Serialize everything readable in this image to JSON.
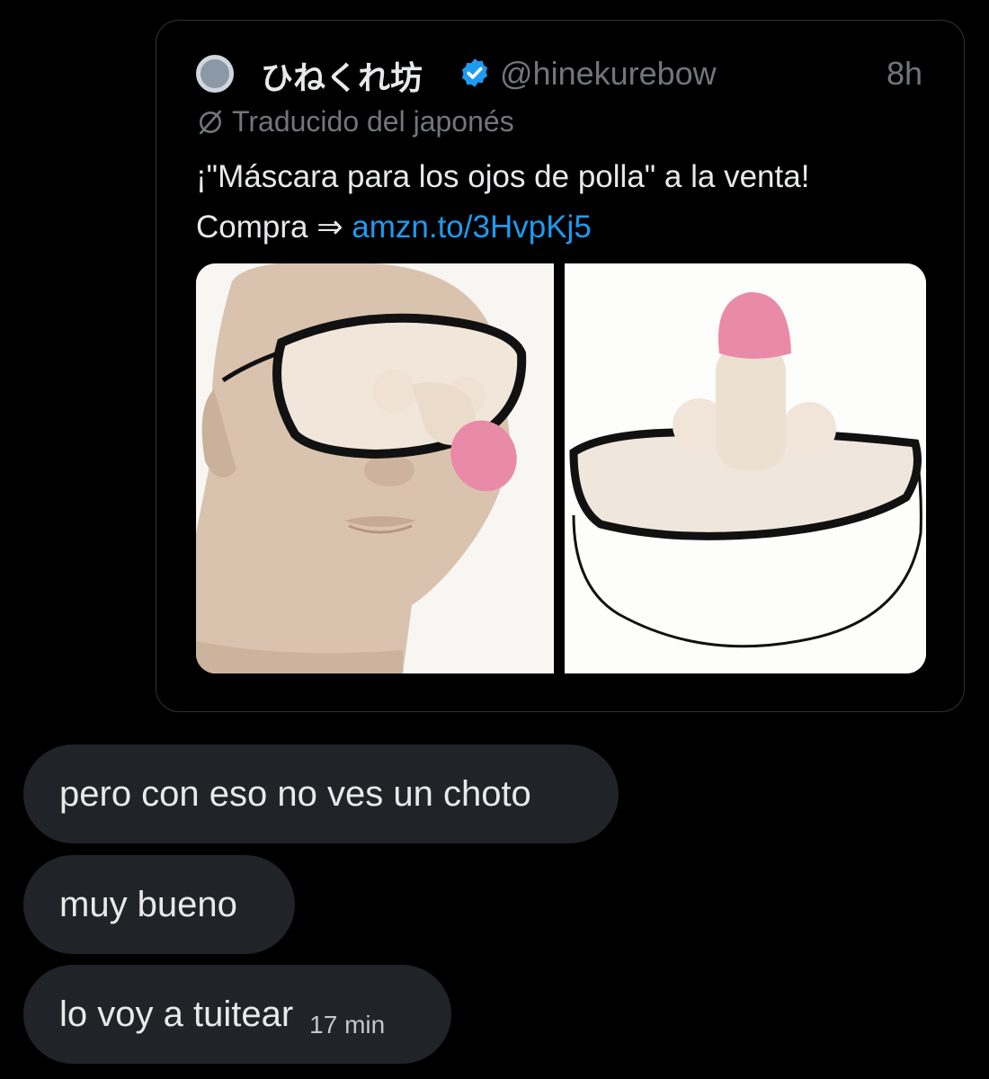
{
  "quoted_tweet": {
    "display_name": "ひねくれ坊",
    "handle": "@hinekurebow",
    "time": "8h",
    "translation_note": "Traducido del japonés",
    "text_line1": "¡\"Máscara para los ojos de polla\" a la venta!",
    "text_line2_prefix": "Compra ⇒ ",
    "link": "amzn.to/3HvpKj5",
    "colors": {
      "link": "#1d9bf0",
      "verified": "#1d9bf0",
      "muted": "#71767b"
    },
    "icons": {
      "verified": "verified-badge-icon",
      "translate": "translate-icon"
    }
  },
  "messages": [
    {
      "text": "pero con eso no ves un choto"
    },
    {
      "text": "muy bueno"
    },
    {
      "text": "lo voy a tuitear",
      "timestamp": "17 min"
    }
  ]
}
